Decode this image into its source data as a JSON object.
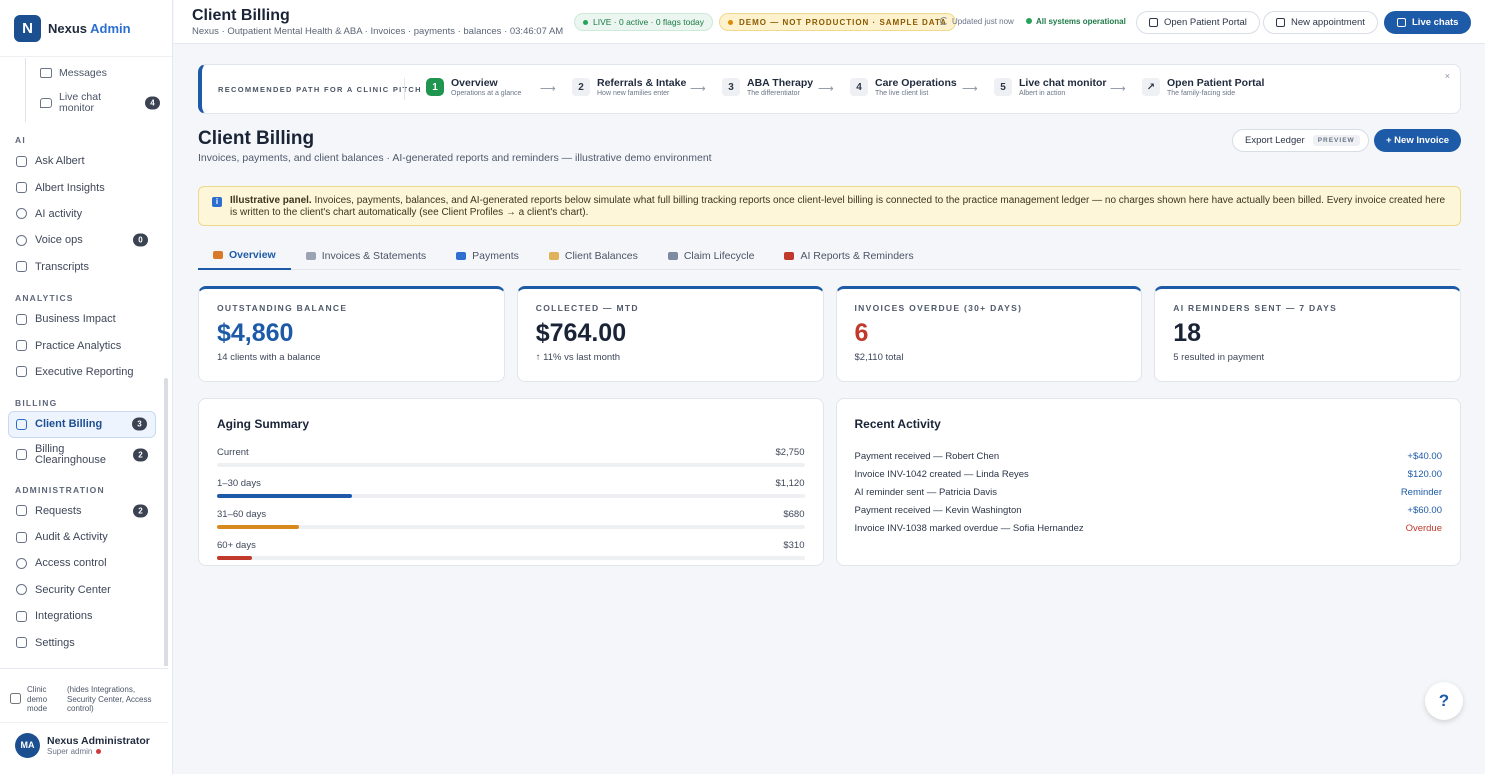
{
  "brand": {
    "logo_letter": "N",
    "name": "Nexus",
    "name_accent": "Admin"
  },
  "sidebar": {
    "sub_items": [
      {
        "label": "Messages",
        "icon": "mail-icon"
      },
      {
        "label": "Live chat monitor",
        "icon": "chat-icon",
        "badge": "4"
      }
    ],
    "sections": [
      {
        "label": "AI",
        "items": [
          {
            "label": "Ask Albert",
            "icon": "chat-icon"
          },
          {
            "label": "Albert Insights",
            "icon": "pencil-icon"
          },
          {
            "label": "AI activity",
            "icon": "user-icon"
          },
          {
            "label": "Voice ops",
            "icon": "phone-icon",
            "badge": "0"
          },
          {
            "label": "Transcripts",
            "icon": "document-icon"
          }
        ]
      },
      {
        "label": "ANALYTICS",
        "items": [
          {
            "label": "Business Impact",
            "icon": "trend-icon"
          },
          {
            "label": "Practice Analytics",
            "icon": "bar-chart-icon"
          },
          {
            "label": "Executive Reporting",
            "icon": "document-icon"
          }
        ]
      },
      {
        "label": "BILLING",
        "items": [
          {
            "label": "Client Billing",
            "icon": "dollar-icon",
            "badge": "3",
            "active": true
          },
          {
            "label": "Billing Clearinghouse",
            "icon": "card-icon",
            "badge": "2"
          }
        ]
      },
      {
        "label": "ADMINISTRATION",
        "items": [
          {
            "label": "Requests",
            "icon": "chat-icon",
            "badge": "2"
          },
          {
            "label": "Audit & Activity",
            "icon": "document-icon"
          },
          {
            "label": "Access control",
            "icon": "user-icon"
          },
          {
            "label": "Security Center",
            "icon": "shield-icon"
          },
          {
            "label": "Integrations",
            "icon": "link-icon"
          },
          {
            "label": "Settings",
            "icon": "gear-icon"
          }
        ]
      }
    ],
    "demo_mode": {
      "label": "Clinic demo mode",
      "note": "(hides Integrations, Security Center, Access control)"
    },
    "user": {
      "initials": "MA",
      "name": "Nexus Administrator",
      "role": "Super admin"
    }
  },
  "header": {
    "title": "Client Billing",
    "crumbs": "Nexus · Outpatient Mental Health & ABA · Invoices · payments · balances · 03:46:07 AM",
    "live_pill": "LIVE · 0 active · 0 flags today",
    "demo_pill": "DEMO — NOT PRODUCTION · SAMPLE DATA",
    "updated_label": "Updated",
    "updated_value": "just now",
    "systems": "All systems operational",
    "buttons": {
      "portal": "Open Patient Portal",
      "appointment": "New appointment",
      "chats": "Live chats"
    }
  },
  "pitch": {
    "label": "RECOMMENDED PATH FOR A CLINIC PITCH",
    "steps": [
      {
        "num": "1",
        "title": "Overview",
        "sub": "Operations at a glance"
      },
      {
        "num": "2",
        "title": "Referrals & Intake",
        "sub": "How new families enter"
      },
      {
        "num": "3",
        "title": "ABA Therapy",
        "sub": "The differentiator"
      },
      {
        "num": "4",
        "title": "Care Operations",
        "sub": "The live client list"
      },
      {
        "num": "5",
        "title": "Live chat monitor",
        "sub": "Albert in action"
      },
      {
        "num": "↗",
        "title": "Open Patient Portal",
        "sub": "The family-facing side"
      }
    ],
    "arrow": "⟶",
    "close": "×"
  },
  "billing": {
    "title": "Client Billing",
    "subtitle": "Invoices, payments, and client balances · AI-generated reports and reminders — illustrative demo environment",
    "export_label": "Export Ledger",
    "export_tag": "PREVIEW",
    "new_invoice": "+ New Invoice",
    "notice_bold": "Illustrative panel.",
    "notice_text": "Invoices, payments, balances, and AI-generated reports below simulate what full billing tracking reports once client-level billing is connected to the practice management ledger — no charges shown here have actually been billed. Every invoice created here is written to the client's chart automatically (see Client Profiles → a client's chart).",
    "notice_icon": "i"
  },
  "tabs": [
    {
      "label": "Overview",
      "color": "#d97a2b",
      "active": true
    },
    {
      "label": "Invoices & Statements",
      "color": "#9aa3b2"
    },
    {
      "label": "Payments",
      "color": "#2c6fd1"
    },
    {
      "label": "Client Balances",
      "color": "#e0b35a"
    },
    {
      "label": "Claim Lifecycle",
      "color": "#7e8aa0"
    },
    {
      "label": "AI Reports & Reminders",
      "color": "#c0392b"
    }
  ],
  "kpis": [
    {
      "label": "OUTSTANDING BALANCE",
      "value": "$4,860",
      "note": "14 clients with a balance",
      "tone": "blue"
    },
    {
      "label": "COLLECTED — MTD",
      "value": "$764.00",
      "note": "↑ 11% vs last month",
      "tone": "dark"
    },
    {
      "label": "INVOICES OVERDUE (30+ DAYS)",
      "value": "6",
      "note": "$2,110 total",
      "tone": "red"
    },
    {
      "label": "AI REMINDERS SENT — 7 DAYS",
      "value": "18",
      "note": "5 resulted in payment",
      "tone": "dark"
    }
  ],
  "aging": {
    "title": "Aging Summary",
    "rows": [
      {
        "label": "Current",
        "amount": "$2,750",
        "fraction": 0.0,
        "color": "#1d5aa7"
      },
      {
        "label": "1–30 days",
        "amount": "$1,120",
        "fraction": 0.23,
        "color": "#1d5aa7"
      },
      {
        "label": "31–60 days",
        "amount": "$680",
        "fraction": 0.14,
        "color": "#d98a1e"
      },
      {
        "label": "60+ days",
        "amount": "$310",
        "fraction": 0.06,
        "color": "#c0392b"
      }
    ]
  },
  "activity": {
    "title": "Recent Activity",
    "rows": [
      {
        "text": "Payment received — Robert Chen",
        "amount": "+$40.00",
        "color": "#1d5aa7"
      },
      {
        "text": "Invoice INV-1042 created — Linda Reyes",
        "amount": "$120.00",
        "color": "#1d5aa7"
      },
      {
        "text": "AI reminder sent — Patricia Davis",
        "amount": "Reminder",
        "color": "#1d5aa7"
      },
      {
        "text": "Payment received — Kevin Washington",
        "amount": "+$60.00",
        "color": "#1d5aa7"
      },
      {
        "text": "Invoice INV-1038 marked overdue — Sofia Hernandez",
        "amount": "Overdue",
        "color": "#c0392b"
      }
    ]
  },
  "help": "?"
}
